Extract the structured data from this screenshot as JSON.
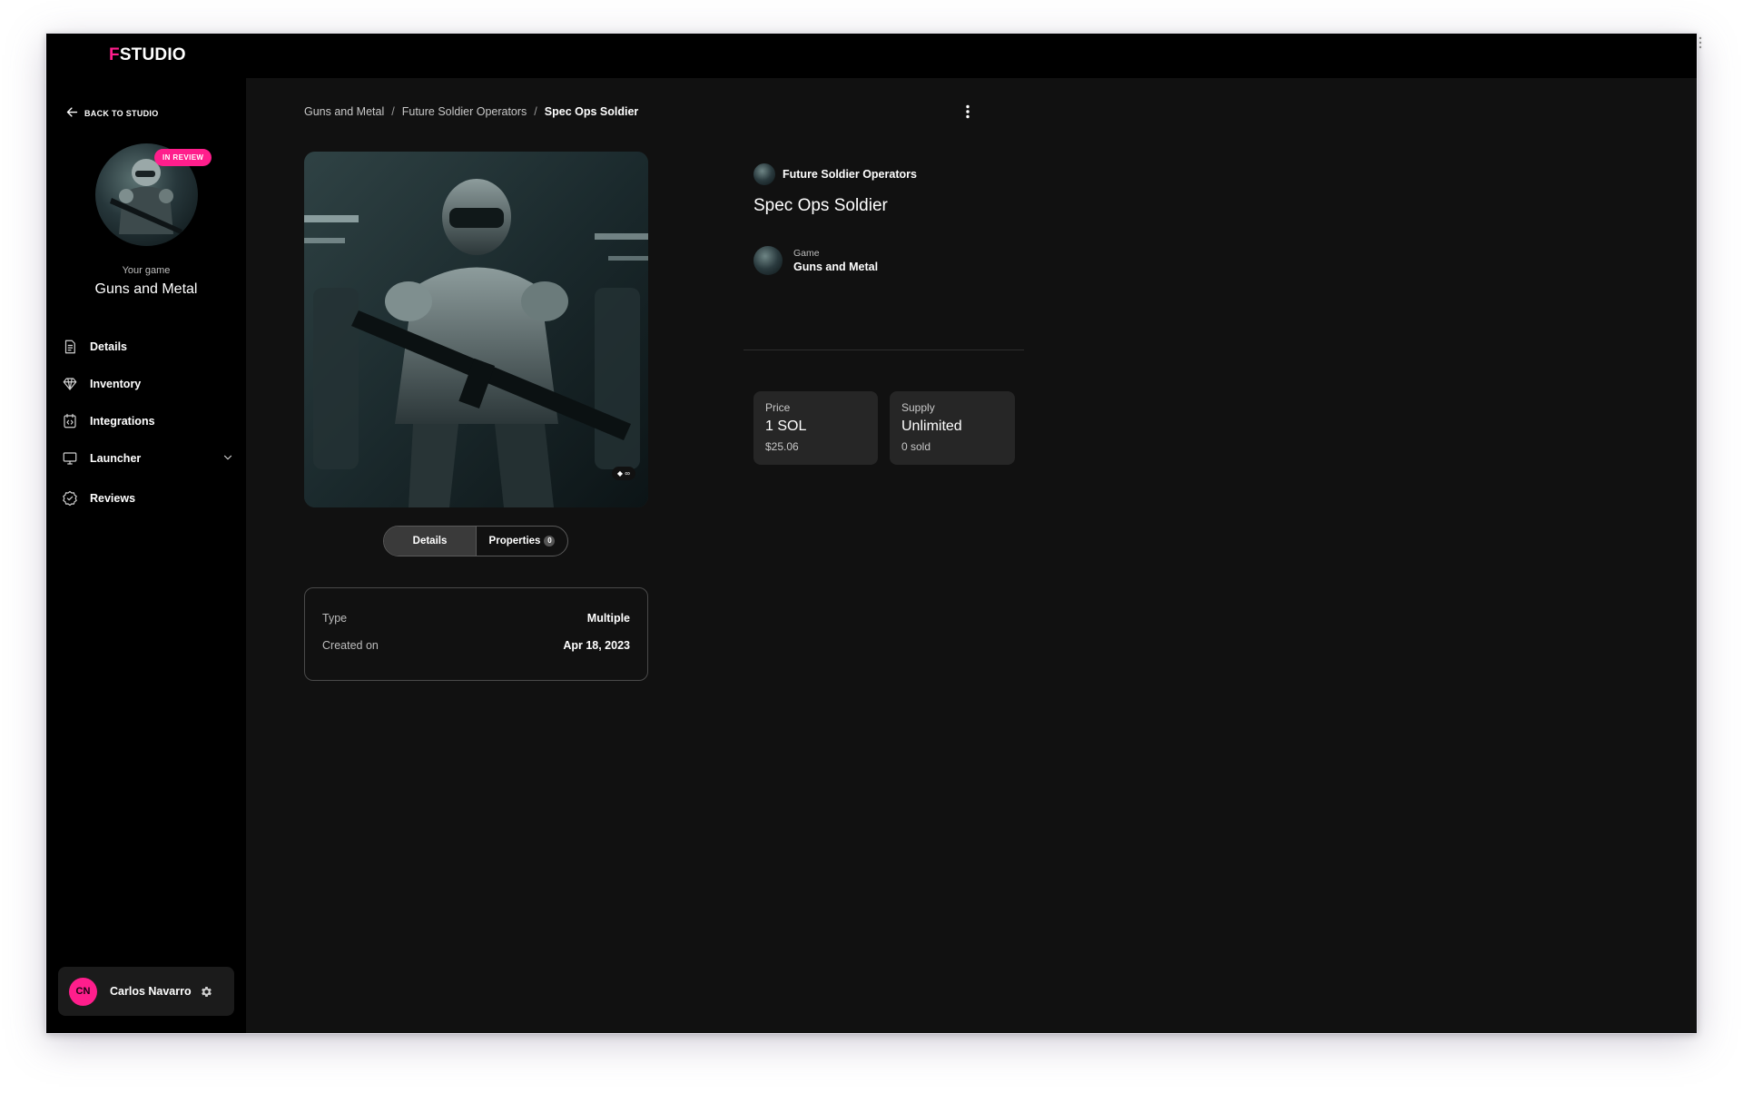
{
  "app": {
    "logo_prefix": "F",
    "logo_rest": "STUDIO"
  },
  "sidebar": {
    "back_label": "BACK TO STUDIO",
    "badge": "IN REVIEW",
    "your_game_label": "Your game",
    "game_name": "Guns and Metal",
    "items": [
      {
        "label": "Details",
        "icon": "document-icon"
      },
      {
        "label": "Inventory",
        "icon": "diamond-icon"
      },
      {
        "label": "Integrations",
        "icon": "code-icon"
      },
      {
        "label": "Launcher",
        "icon": "monitor-icon",
        "expandable": true
      },
      {
        "label": "Reviews",
        "icon": "check-badge-icon"
      }
    ],
    "user": {
      "initials": "CN",
      "name": "Carlos Navarro"
    }
  },
  "breadcrumb": [
    "Guns and Metal",
    "Future Soldier Operators",
    "Spec Ops Soldier"
  ],
  "item": {
    "hero_tag": "∞",
    "tabs": {
      "details": "Details",
      "properties": "Properties",
      "properties_count": "0"
    },
    "info": [
      {
        "key": "Type",
        "value": "Multiple"
      },
      {
        "key": "Created on",
        "value": "Apr 18, 2023"
      }
    ],
    "collection": "Future Soldier Operators",
    "title": "Spec Ops Soldier",
    "game_label": "Game",
    "game_value": "Guns and Metal",
    "price": {
      "label": "Price",
      "value": "1 SOL",
      "usd": "$25.06"
    },
    "supply": {
      "label": "Supply",
      "value": "Unlimited",
      "sold": "0 sold"
    }
  },
  "colors": {
    "accent": "#ff1e8c",
    "background": "#111111",
    "sidebar": "#000000"
  }
}
